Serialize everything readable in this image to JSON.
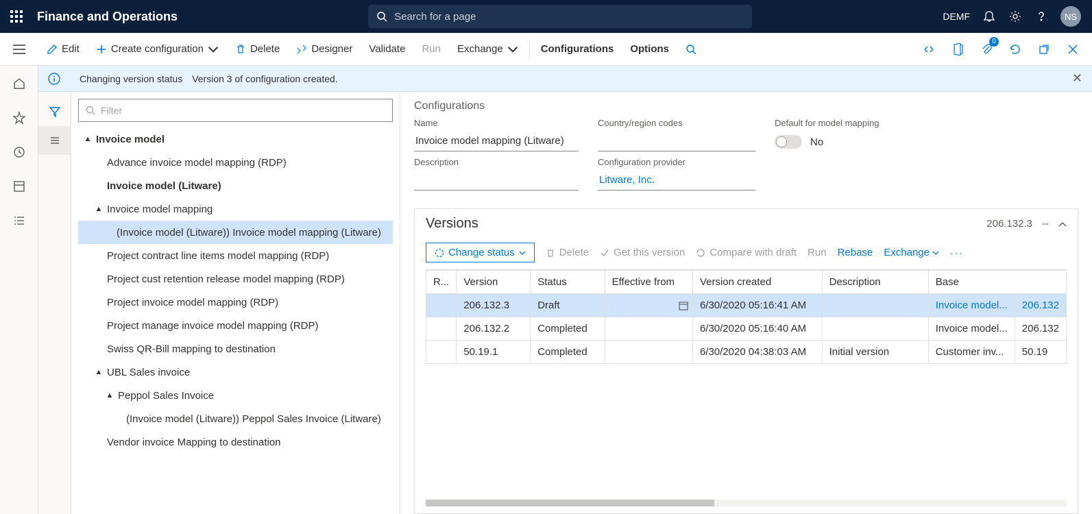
{
  "header": {
    "app_title": "Finance and Operations",
    "search_placeholder": "Search for a page",
    "company": "DEMF",
    "avatar_initials": "NS"
  },
  "action_bar": {
    "edit": "Edit",
    "create_config": "Create configuration",
    "delete": "Delete",
    "designer": "Designer",
    "validate": "Validate",
    "run": "Run",
    "exchange": "Exchange",
    "configurations": "Configurations",
    "options": "Options",
    "attachments_badge": "0"
  },
  "banner": {
    "title": "Changing version status",
    "message": "Version 3 of configuration created."
  },
  "tree": {
    "filter_placeholder": "Filter",
    "items": {
      "root": "Invoice model",
      "adv": "Advance invoice model mapping (RDP)",
      "litware": "Invoice model (Litware)",
      "mapping_head": "Invoice model mapping",
      "mapping_sel": "(Invoice model (Litware)) Invoice model mapping (Litware)",
      "pcl": "Project contract line items model mapping (RDP)",
      "pcr": "Project cust retention release model mapping (RDP)",
      "pimm": "Project invoice model mapping (RDP)",
      "pmimm": "Project manage invoice model mapping (RDP)",
      "swiss": "Swiss QR-Bill mapping to destination",
      "ubl": "UBL Sales invoice",
      "peppol": "Peppol Sales Invoice",
      "peppol_lit": "(Invoice model (Litware)) Peppol Sales Invoice (Litware)",
      "vendor": "Vendor invoice Mapping to destination"
    }
  },
  "details": {
    "section_title": "Configurations",
    "name_label": "Name",
    "name_value": "Invoice model mapping (Litware)",
    "region_label": "Country/region codes",
    "default_label": "Default for model mapping",
    "default_value": "No",
    "description_label": "Description",
    "provider_label": "Configuration provider",
    "provider_value": "Litware, Inc."
  },
  "versions": {
    "title": "Versions",
    "summary_version": "206.132.3",
    "summary_dash": "--",
    "toolbar": {
      "change_status": "Change status",
      "delete": "Delete",
      "get_this_version": "Get this version",
      "compare": "Compare with draft",
      "run": "Run",
      "rebase": "Rebase",
      "exchange": "Exchange"
    },
    "columns": {
      "r": "R...",
      "version": "Version",
      "status": "Status",
      "eff": "Effective from",
      "created": "Version created",
      "desc": "Description",
      "base": "Base",
      "base2": ""
    },
    "rows": [
      {
        "version": "206.132.3",
        "status": "Draft",
        "eff": "",
        "created": "6/30/2020 05:16:41 AM",
        "desc": "",
        "base": "Invoice model...",
        "base_ver": "206.132",
        "selected": true
      },
      {
        "version": "206.132.2",
        "status": "Completed",
        "eff": "",
        "created": "6/30/2020 05:16:40 AM",
        "desc": "",
        "base": "Invoice model...",
        "base_ver": "206.132",
        "selected": false
      },
      {
        "version": "50.19.1",
        "status": "Completed",
        "eff": "",
        "created": "6/30/2020 04:38:03 AM",
        "desc": "Initial version",
        "base": "Customer inv...",
        "base_ver": "50.19",
        "selected": false
      }
    ]
  }
}
